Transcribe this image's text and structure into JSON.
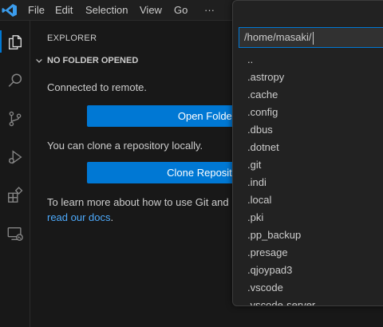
{
  "menu": {
    "file": "File",
    "edit": "Edit",
    "selection": "Selection",
    "view": "View",
    "go": "Go",
    "more": "···"
  },
  "activity_bar": {
    "icons": [
      "files-icon",
      "search-icon",
      "source-control-icon",
      "run-debug-icon",
      "extensions-icon",
      "remote-explorer-icon"
    ]
  },
  "sidebar": {
    "title": "EXPLORER",
    "section_header": "NO FOLDER OPENED",
    "connected_text": "Connected to remote.",
    "open_folder_label": "Open Folder",
    "clone_text": "You can clone a repository locally.",
    "clone_button_label": "Clone Repository",
    "learn_text_1": "To learn more about how to use Git and",
    "learn_link": "read our docs",
    "learn_text_end": "."
  },
  "quick_pick": {
    "input_value": "/home/masaki/",
    "items": [
      "..",
      ".astropy",
      ".cache",
      ".config",
      ".dbus",
      ".dotnet",
      ".git",
      ".indi",
      ".local",
      ".pki",
      ".pp_backup",
      ".presage",
      ".qjoypad3",
      ".vscode",
      ".vscode-server"
    ]
  },
  "colors": {
    "accent": "#0078d4",
    "link": "#4daafc",
    "background": "#181818"
  }
}
